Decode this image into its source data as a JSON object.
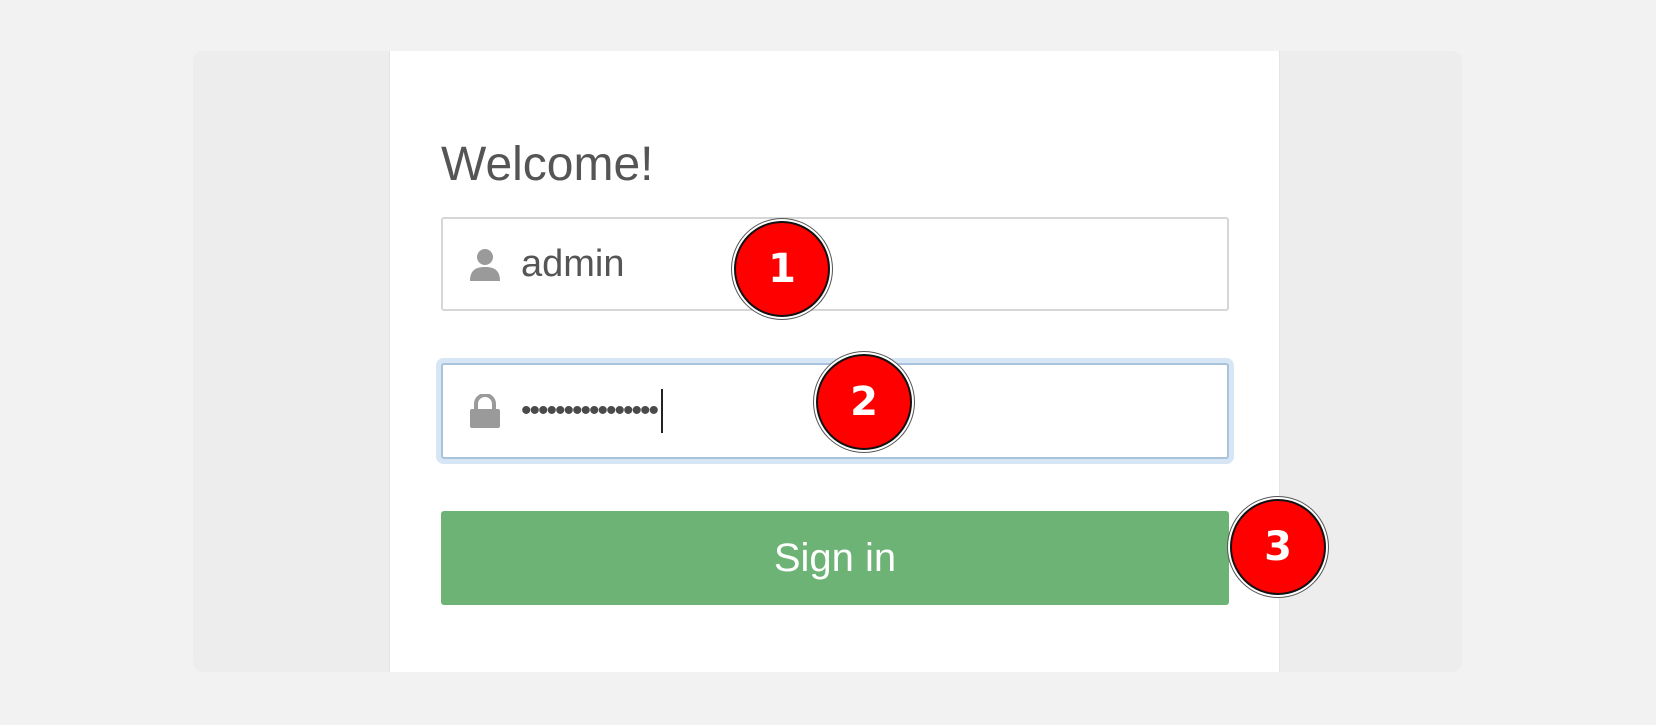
{
  "login": {
    "title": "Welcome!",
    "username": {
      "icon": "user-icon",
      "value": "admin"
    },
    "password": {
      "icon": "lock-icon",
      "masked_value": "••••••••••••••••"
    },
    "signin_label": "Sign in"
  },
  "markers": [
    {
      "label": "1"
    },
    {
      "label": "2"
    },
    {
      "label": "3"
    }
  ],
  "colors": {
    "background": "#f2f2f2",
    "panel": "#ededed",
    "card": "#ffffff",
    "signin_button": "#6db375",
    "marker": "#ff0000",
    "focus_ring": "#d6e6f5"
  }
}
